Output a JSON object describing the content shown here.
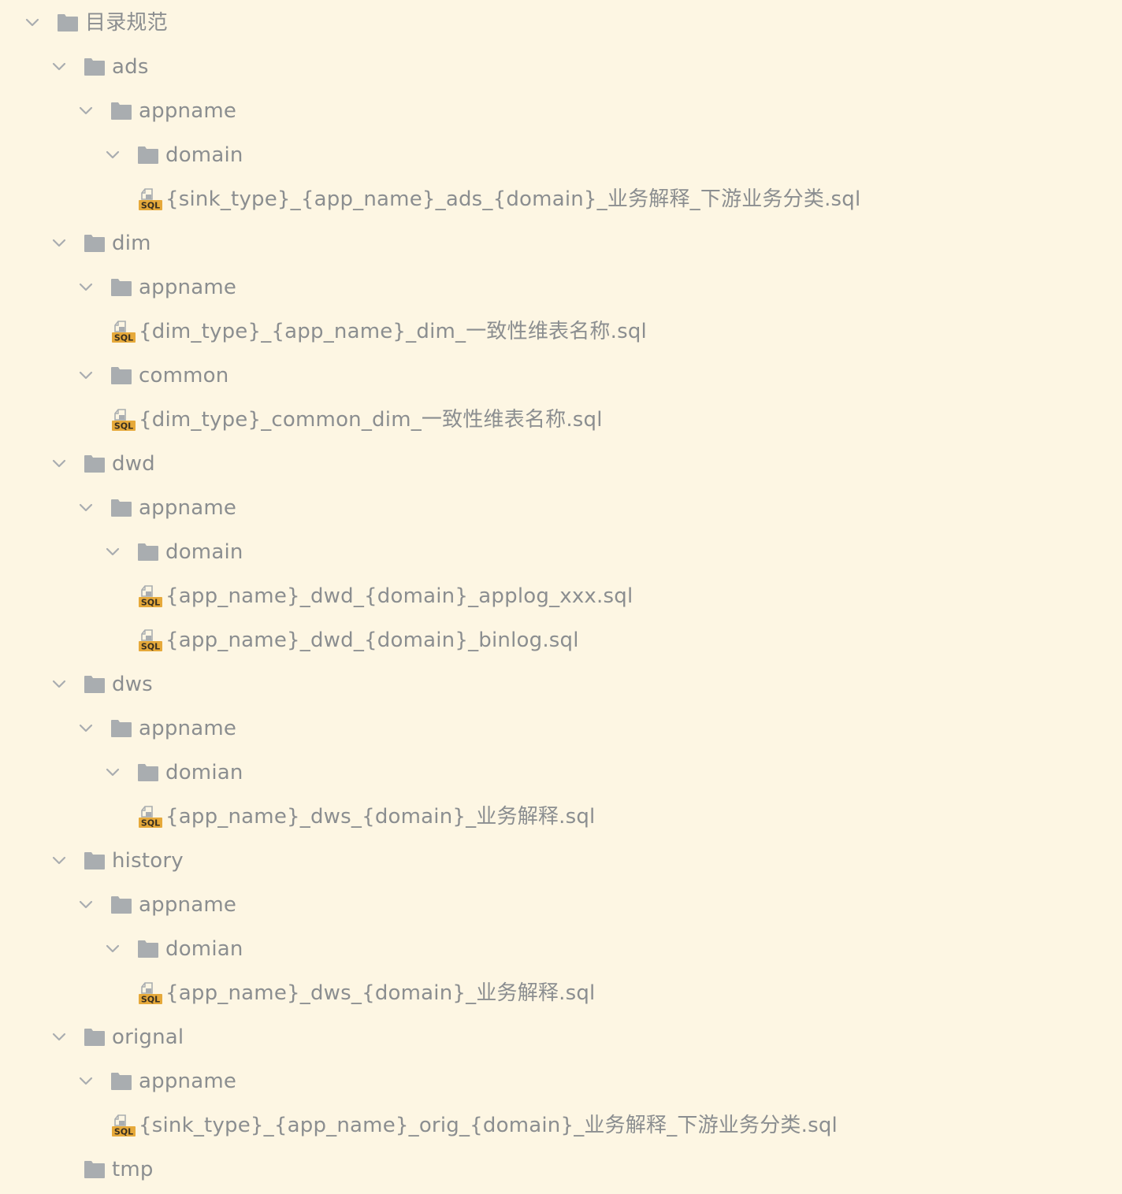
{
  "colors": {
    "background": "#fdf6e3",
    "text": "#8b8e90",
    "folder": "#a9adb0",
    "chevron": "#a9adb0",
    "sql_badge": "#e6a93a"
  },
  "sql_badge_text": "SQL",
  "tree": [
    {
      "kind": "folder",
      "depth": 0,
      "expanded": true,
      "label": "目录规范"
    },
    {
      "kind": "folder",
      "depth": 1,
      "expanded": true,
      "label": "ads"
    },
    {
      "kind": "folder",
      "depth": 2,
      "expanded": true,
      "label": "appname"
    },
    {
      "kind": "folder",
      "depth": 3,
      "expanded": true,
      "label": "domain"
    },
    {
      "kind": "file",
      "depth": 4,
      "label": "{sink_type}_{app_name}_ads_{domain}_业务解释_下游业务分类.sql"
    },
    {
      "kind": "folder",
      "depth": 1,
      "expanded": true,
      "label": "dim"
    },
    {
      "kind": "folder",
      "depth": 2,
      "expanded": true,
      "label": "appname"
    },
    {
      "kind": "file",
      "depth": 3,
      "label": "{dim_type}_{app_name}_dim_一致性维表名称.sql"
    },
    {
      "kind": "folder",
      "depth": 2,
      "expanded": true,
      "label": "common"
    },
    {
      "kind": "file",
      "depth": 3,
      "label": "{dim_type}_common_dim_一致性维表名称.sql"
    },
    {
      "kind": "folder",
      "depth": 1,
      "expanded": true,
      "label": "dwd"
    },
    {
      "kind": "folder",
      "depth": 2,
      "expanded": true,
      "label": "appname"
    },
    {
      "kind": "folder",
      "depth": 3,
      "expanded": true,
      "label": "domain"
    },
    {
      "kind": "file",
      "depth": 4,
      "label": "{app_name}_dwd_{domain}_applog_xxx.sql"
    },
    {
      "kind": "file",
      "depth": 4,
      "label": "{app_name}_dwd_{domain}_binlog.sql"
    },
    {
      "kind": "folder",
      "depth": 1,
      "expanded": true,
      "label": "dws"
    },
    {
      "kind": "folder",
      "depth": 2,
      "expanded": true,
      "label": "appname"
    },
    {
      "kind": "folder",
      "depth": 3,
      "expanded": true,
      "label": "domian"
    },
    {
      "kind": "file",
      "depth": 4,
      "label": "{app_name}_dws_{domain}_业务解释.sql"
    },
    {
      "kind": "folder",
      "depth": 1,
      "expanded": true,
      "label": "history"
    },
    {
      "kind": "folder",
      "depth": 2,
      "expanded": true,
      "label": "appname"
    },
    {
      "kind": "folder",
      "depth": 3,
      "expanded": true,
      "label": "domian"
    },
    {
      "kind": "file",
      "depth": 4,
      "label": "{app_name}_dws_{domain}_业务解释.sql"
    },
    {
      "kind": "folder",
      "depth": 1,
      "expanded": true,
      "label": "orignal"
    },
    {
      "kind": "folder",
      "depth": 2,
      "expanded": true,
      "label": "appname"
    },
    {
      "kind": "file",
      "depth": 3,
      "label": "{sink_type}_{app_name}_orig_{domain}_业务解释_下游业务分类.sql"
    },
    {
      "kind": "folder",
      "depth": 1,
      "expanded": false,
      "leaf": true,
      "label": "tmp"
    }
  ]
}
